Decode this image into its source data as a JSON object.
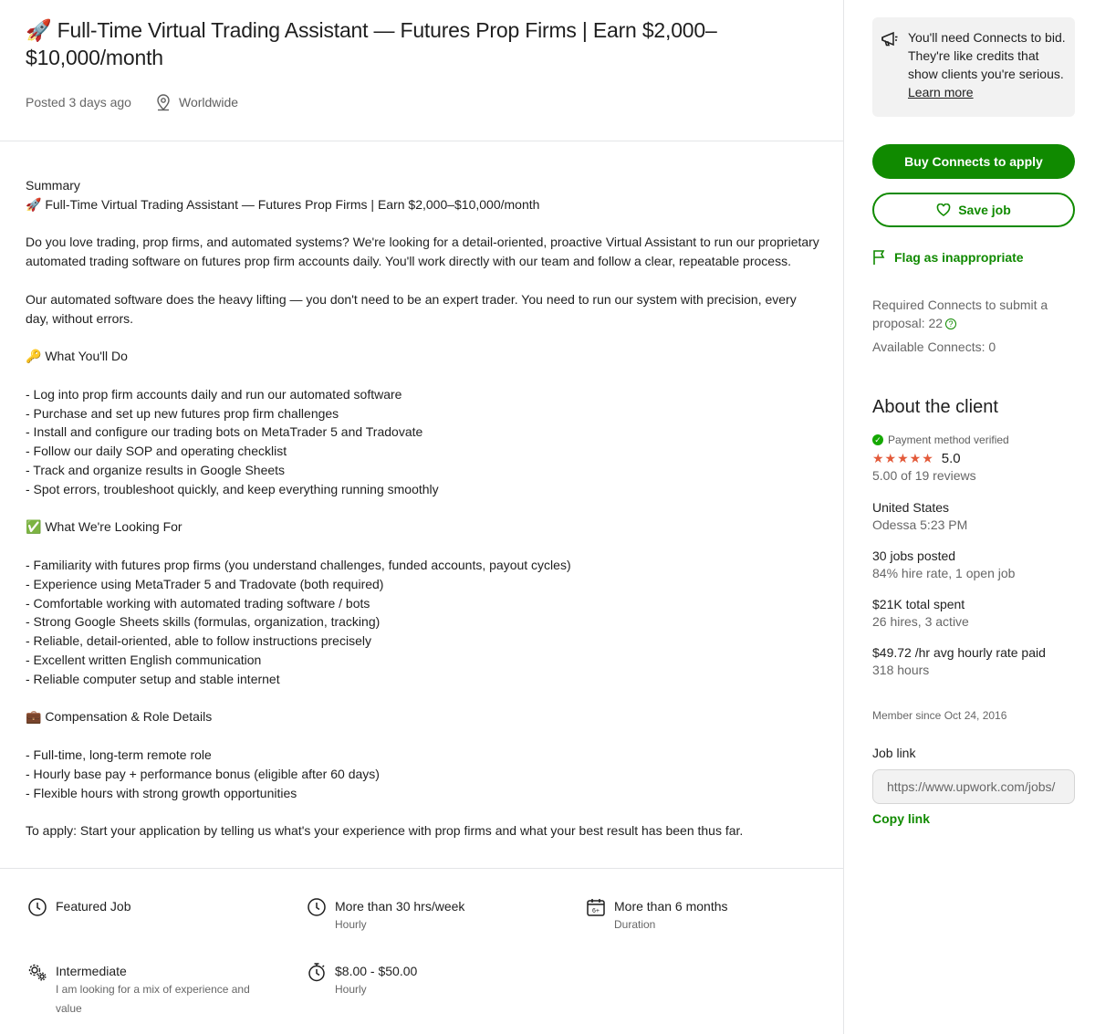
{
  "job": {
    "title": "🚀 Full-Time Virtual Trading Assistant — Futures Prop Firms | Earn $2,000–$10,000/month",
    "posted": "Posted 3 days ago",
    "location": "Worldwide"
  },
  "description": {
    "lines": [
      "Summary",
      "🚀 Full-Time Virtual Trading Assistant — Futures Prop Firms | Earn $2,000–$10,000/month",
      "",
      "Do you love trading, prop firms, and automated systems? We're looking for a detail-oriented, proactive Virtual Assistant to run our proprietary automated trading software on futures prop firm accounts daily. You'll work directly with our team and follow a clear, repeatable process.",
      "",
      "Our automated software does the heavy lifting — you don't need to be an expert trader. You need to run our system with precision, every day, without errors.",
      "",
      "🔑 What You'll Do",
      "",
      "- Log into prop firm accounts daily and run our automated software",
      "- Purchase and set up new futures prop firm challenges",
      "- Install and configure our trading bots on MetaTrader 5 and Tradovate",
      "- Follow our daily SOP and operating checklist",
      "- Track and organize results in Google Sheets",
      "- Spot errors, troubleshoot quickly, and keep everything running smoothly",
      "",
      "✅ What We're Looking For",
      "",
      "- Familiarity with futures prop firms (you understand challenges, funded accounts, payout cycles)",
      "- Experience using MetaTrader 5 and Tradovate (both required)",
      "- Comfortable working with automated trading software / bots",
      "- Strong Google Sheets skills (formulas, organization, tracking)",
      "- Reliable, detail-oriented, able to follow instructions precisely",
      "- Excellent written English communication",
      "- Reliable computer setup and stable internet",
      "",
      "💼 Compensation & Role Details",
      "",
      "- Full-time, long-term remote role",
      "- Hourly base pay + performance bonus (eligible after 60 days)",
      "- Flexible hours with strong growth opportunities",
      "",
      "To apply: Start your application by telling us what's your experience with prop firms and what your best result has been thus far."
    ]
  },
  "features": {
    "featured": {
      "title": "Featured Job",
      "icon": "clock-icon"
    },
    "hours": {
      "title": "More than 30 hrs/week",
      "sub": "Hourly",
      "icon": "clock-icon"
    },
    "duration": {
      "title": "More than 6 months",
      "sub": "Duration",
      "icon": "calendar-icon"
    },
    "level": {
      "title": "Intermediate",
      "sub": "I am looking for a mix of experience and value",
      "icon": "gears-icon"
    },
    "rate": {
      "title": "$8.00 - $50.00",
      "sub": "Hourly",
      "icon": "stopwatch-icon"
    }
  },
  "sidebar": {
    "connects_note": "You'll need Connects to bid. They're like credits that show clients you're serious.",
    "learn_more": "Learn more",
    "buy_button": "Buy Connects to apply",
    "save_button": "Save job",
    "flag": "Flag as inappropriate",
    "required_connects": "Required Connects to submit a proposal: 22",
    "available_connects": "Available Connects: 0",
    "help_glyph": "?",
    "accent": "#108a00"
  },
  "client": {
    "heading": "About the client",
    "payment": "Payment method verified",
    "stars": "★★★★★",
    "score": "5.0",
    "reviews": "5.00 of 19 reviews",
    "country": "United States",
    "local_time": "Odessa 5:23 PM",
    "jobs_posted": "30 jobs posted",
    "hire_rate": "84% hire rate, 1 open job",
    "total_spent": "$21K total spent",
    "hires": "26 hires, 3 active",
    "avg_rate": "$49.72 /hr avg hourly rate paid",
    "hours": "318 hours",
    "member_since": "Member since Oct 24, 2016",
    "job_link_label": "Job link",
    "job_link_value": "https://www.upwork.com/jobs/",
    "copy_link": "Copy link"
  }
}
